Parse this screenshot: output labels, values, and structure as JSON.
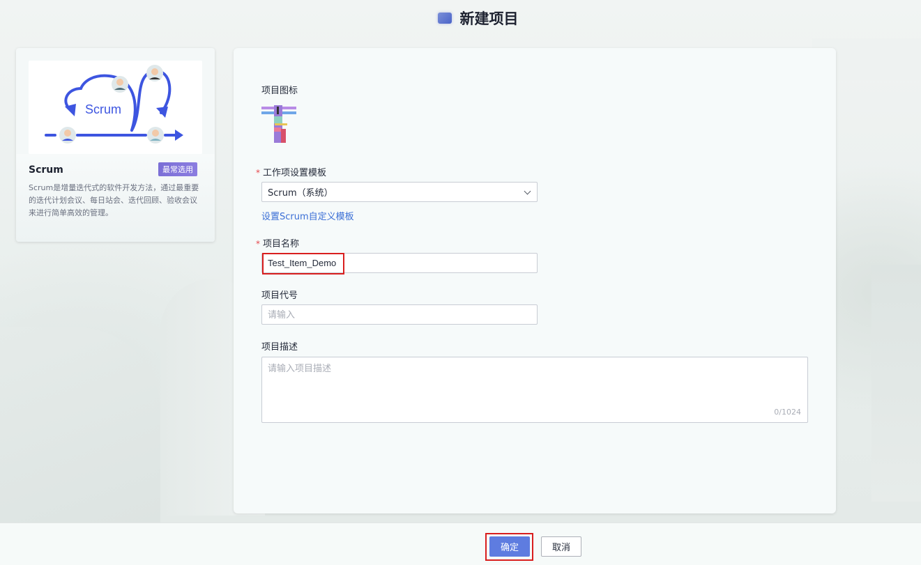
{
  "header": {
    "title": "新建项目",
    "icon": "project-icon"
  },
  "template_card": {
    "illustration_text": "Scrum",
    "name": "Scrum",
    "badge": "最常选用",
    "description": "Scrum是增量迭代式的软件开发方法，通过最重要的迭代计划会议、每日站会、迭代回顾、验收会议来进行简单高效的管理。"
  },
  "form": {
    "icon_label": "项目图标",
    "template_label": "工作项设置模板",
    "template_value": "Scrum（系统）",
    "template_link": "设置Scrum自定义模板",
    "name_label": "项目名称",
    "name_value": "Test_Item_Demo",
    "code_label": "项目代号",
    "code_placeholder": "请输入",
    "desc_label": "项目描述",
    "desc_placeholder": "请输入项目描述",
    "desc_counter": "0/1024",
    "required_mark": "*"
  },
  "footer": {
    "confirm_label": "确定",
    "cancel_label": "取消"
  },
  "colors": {
    "primary": "#5e7ce0",
    "link": "#3b6fd6",
    "highlight": "#d91e1e",
    "required": "#e5484d",
    "badge": "#7b6fd6"
  }
}
